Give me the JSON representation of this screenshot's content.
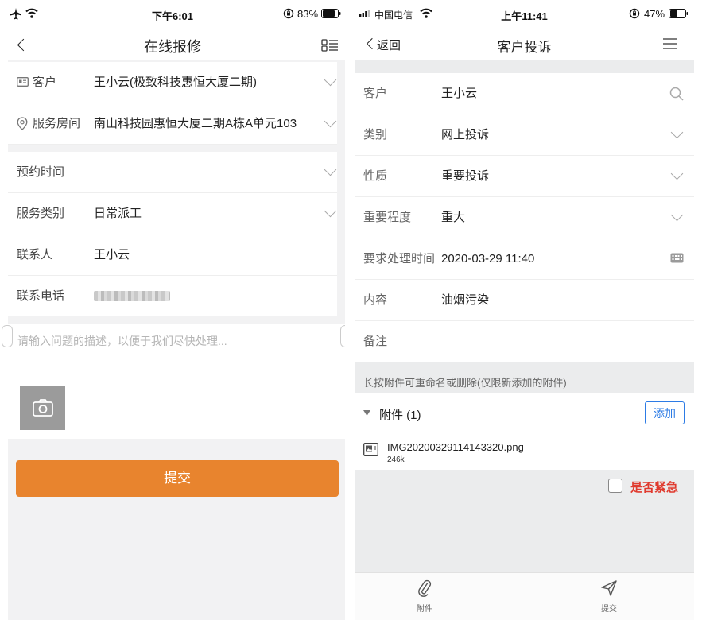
{
  "left": {
    "status": {
      "time": "下午6:01",
      "battery": "83%"
    },
    "title": "在线报修",
    "fields": {
      "customer": {
        "label": "客户",
        "value": "王小云(极致科技惠恒大厦二期)"
      },
      "room": {
        "label": "服务房间",
        "value": "南山科技园惠恒大厦二期A栋A单元103"
      },
      "appointment": {
        "label": "预约时间",
        "value": ""
      },
      "service_type": {
        "label": "服务类别",
        "value": "日常派工"
      },
      "contact": {
        "label": "联系人",
        "value": "王小云"
      },
      "phone": {
        "label": "联系电话"
      }
    },
    "description_placeholder": "请输入问题的描述，以便于我们尽快处理...",
    "submit_label": "提交"
  },
  "right": {
    "status": {
      "carrier": "中国电信",
      "time": "上午11:41",
      "battery": "47%"
    },
    "back_label": "返回",
    "title": "客户投诉",
    "fields": {
      "customer": {
        "label": "客户",
        "value": "王小云"
      },
      "category": {
        "label": "类别",
        "value": "网上投诉"
      },
      "nature": {
        "label": "性质",
        "value": "重要投诉"
      },
      "severity": {
        "label": "重要程度",
        "value": "重大"
      },
      "deadline": {
        "label": "要求处理时间",
        "value": "2020-03-29 11:40"
      },
      "content": {
        "label": "内容",
        "value": "油烟污染"
      },
      "remark": {
        "label": "备注"
      }
    },
    "attachment_hint": "长按附件可重命名或删除(仅限新添加的附件)",
    "attachments_header": "附件 (1)",
    "add_label": "添加",
    "attachment": {
      "name": "IMG20200329114143320.png",
      "size": "246k"
    },
    "urgent_label": "是否紧急",
    "urgent_checked": false,
    "tabbar": {
      "attach_label": "附件",
      "submit_label": "提交"
    },
    "colors": {
      "accent": "#2c7be5",
      "urgent": "#e03a2e",
      "submit": "#e8842e"
    }
  }
}
